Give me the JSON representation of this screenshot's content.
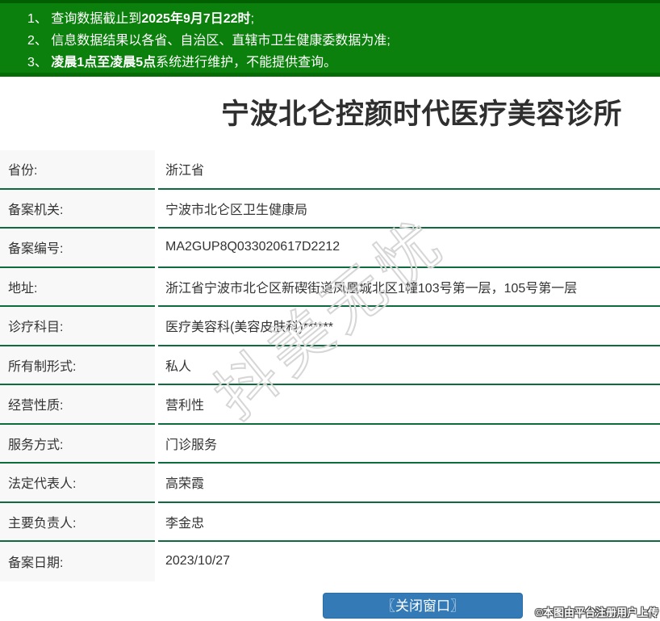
{
  "notice_bar": {
    "lines": [
      {
        "parts": [
          {
            "text": "1、 查询数据截止到",
            "bold": false
          },
          {
            "text": "2025年9月7日22时",
            "bold": true
          },
          {
            "text": ";",
            "bold": false
          }
        ]
      },
      {
        "parts": [
          {
            "text": "2、 信息数据结果以各省、自治区、直辖市卫生健康委数据为准;",
            "bold": false
          }
        ]
      },
      {
        "parts": [
          {
            "text": "3、 ",
            "bold": false
          },
          {
            "text": "凌晨1点至凌晨5点",
            "bold": true
          },
          {
            "text": "系统进行维护，不能提供查询。",
            "bold": false
          }
        ]
      }
    ]
  },
  "title": "宁波北仑控颜时代医疗美容诊所",
  "record": {
    "fields": [
      {
        "label": "省份:",
        "value": "浙江省"
      },
      {
        "label": "备案机关:",
        "value": "宁波市北仑区卫生健康局"
      },
      {
        "label": "备案编号:",
        "value": "MA2GUP8Q033020617D2212"
      },
      {
        "label": "地址:",
        "value": "浙江省宁波市北仑区新碶街道凤凰城北区1幢103号第一层，105号第一层"
      },
      {
        "label": "诊疗科目:",
        "value": "医疗美容科(美容皮肤科)******"
      },
      {
        "label": "所有制形式:",
        "value": "私人"
      },
      {
        "label": "经营性质:",
        "value": "营利性"
      },
      {
        "label": "服务方式:",
        "value": "门诊服务"
      },
      {
        "label": "法定代表人:",
        "value": "高荣霞"
      },
      {
        "label": "主要负责人:",
        "value": "李金忠"
      },
      {
        "label": "备案日期:",
        "value": "2023/10/27"
      }
    ]
  },
  "footer": {
    "close_button_label": "〖关闭窗口〗",
    "credit_text": "©本图由平台注册用户上传"
  },
  "watermark_text": "抖美无忧",
  "colors": {
    "banner_green": "#0c800c",
    "banner_green_dark": "#015f01",
    "separator_green": "#0f6a3f",
    "label_bg": "#f8f8f8",
    "button_blue": "#337ab7",
    "text_dark": "#333333"
  }
}
